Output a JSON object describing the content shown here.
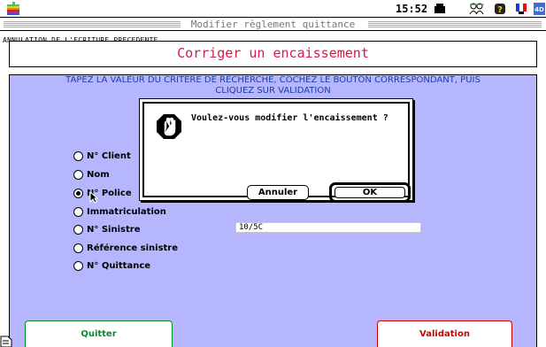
{
  "menubar": {
    "clock": "15:52",
    "icons": [
      "apple-icon",
      "printer-icon",
      "people-icon",
      "help-icon",
      "flag-icon",
      "4d-icon"
    ]
  },
  "window": {
    "title": "Modifier règlement quittance"
  },
  "header": {
    "small_label": "ANNULATION DE L'ECRITURE PRECEDENTE",
    "title": "Corriger un encaissement"
  },
  "instructions": {
    "line1": "TAPEZ LA VALEUR DU CRITERE DE RECHERCHE,  COCHEZ LE BOUTON CORRESPONDANT, PUIS",
    "line2": "CLIQUEZ SUR VALIDATION"
  },
  "search_criteria": {
    "options": [
      {
        "label": "N° Client",
        "selected": false
      },
      {
        "label": "Nom",
        "selected": false
      },
      {
        "label": "N° Police",
        "selected": true
      },
      {
        "label": "Immatriculation",
        "selected": false
      },
      {
        "label": "N° Sinistre",
        "selected": false
      },
      {
        "label": "Référence sinistre",
        "selected": false
      },
      {
        "label": "N° Quittance",
        "selected": false
      }
    ],
    "value": "10/5C"
  },
  "buttons": {
    "quit": "Quitter",
    "validate": "Validation"
  },
  "dialog": {
    "message": "Voulez-vous modifier l'encaissement ?",
    "cancel": "Annuler",
    "ok": "OK"
  },
  "colors": {
    "panel_bg": "#b6b6ff",
    "instructions": "#1f3da3",
    "title": "#d11c48",
    "quit": "#0a8a2a",
    "validate": "#d10000"
  }
}
